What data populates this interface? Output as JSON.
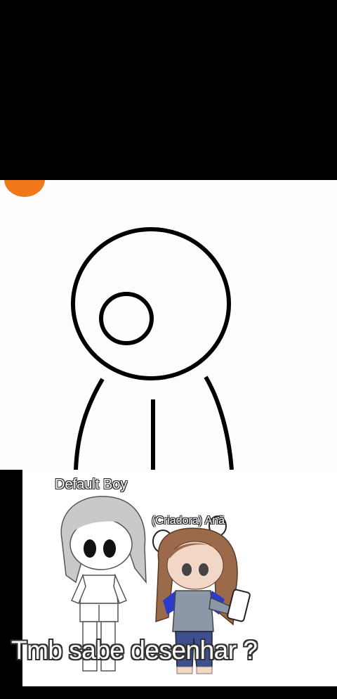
{
  "characters": {
    "left_name": "Default Boy",
    "right_name": "(Criadora) Anã"
  },
  "caption": "Tmb sabe desenhar ?",
  "colors": {
    "accent_dot": "#f07a1a",
    "background": "#000000",
    "canvas": "#fdfdfd"
  }
}
